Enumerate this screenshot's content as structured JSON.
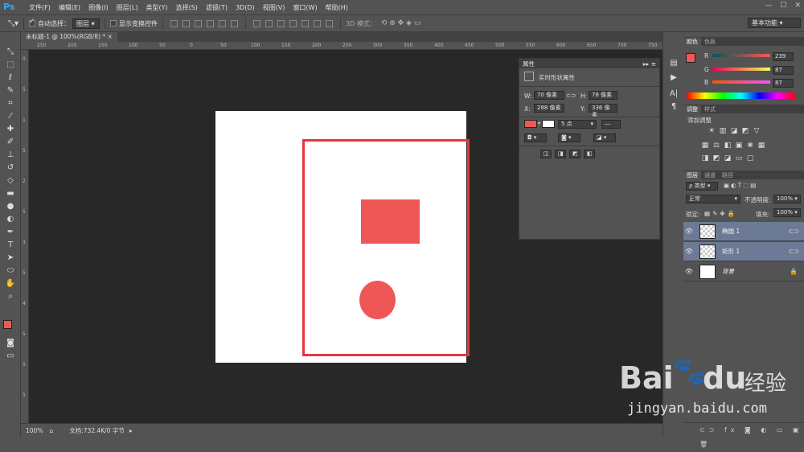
{
  "app": {
    "logo": "Ps"
  },
  "menu": [
    "文件(F)",
    "编辑(E)",
    "图像(I)",
    "图层(L)",
    "类型(Y)",
    "选择(S)",
    "滤镜(T)",
    "3D(D)",
    "视图(V)",
    "窗口(W)",
    "帮助(H)"
  ],
  "window_controls": [
    "—",
    "☐",
    "✕"
  ],
  "options": {
    "auto_select_label": "自动选择：",
    "auto_select_value": "图层",
    "show_transform_label": "显示变换控件",
    "mode_3d_label": "3D 模式：",
    "workspace": "基本功能"
  },
  "document": {
    "tab_title": "未标题-1 @ 100%(RGB/8) *"
  },
  "rulers": {
    "top": [
      "250",
      "200",
      "150",
      "100",
      "50",
      "0",
      "50",
      "100",
      "150",
      "200",
      "250",
      "300",
      "350",
      "400",
      "450",
      "500",
      "550",
      "600",
      "650",
      "700",
      "750"
    ],
    "left": [
      "0",
      "5",
      "1",
      "5",
      "2",
      "5",
      "3",
      "5",
      "4",
      "5",
      "5",
      "5"
    ]
  },
  "status": {
    "zoom": "100%",
    "doc_info": "文档:732.4K/0 字节"
  },
  "properties": {
    "title": "属性",
    "section": "实时形状属性",
    "w_label": "W:",
    "w_value": "70 像素",
    "h_label": "H:",
    "h_value": "78 像素",
    "x_label": "X:",
    "x_value": "288 像素",
    "y_label": "Y:",
    "y_value": "336 像素",
    "stroke_size": "5 点"
  },
  "color_panel": {
    "tabs": [
      "颜色",
      "色板"
    ],
    "r_label": "R",
    "r_value": "239",
    "g_label": "G",
    "g_value": "87",
    "b_label": "B",
    "b_value": "87",
    "fg_color": "#ef5757"
  },
  "adjust_panel": {
    "tabs": [
      "调整",
      "样式"
    ],
    "title": "添加调整"
  },
  "layers_panel": {
    "tabs": [
      "图层",
      "通道",
      "路径"
    ],
    "filter_label": "ρ 类型",
    "blend_mode": "正常",
    "opacity_label": "不透明度:",
    "opacity_value": "100%",
    "lock_label": "锁定:",
    "fill_label": "填充:",
    "fill_value": "100%",
    "layers": [
      {
        "name": "椭圆 1"
      },
      {
        "name": "矩形 1"
      },
      {
        "name": "背景"
      }
    ]
  },
  "watermark": {
    "brand": "Bai",
    "brand2": "du",
    "cn": "经验",
    "url": "jingyan.baidu.com"
  },
  "colors": {
    "accent": "#ef5757",
    "stroke": "#e8343a",
    "selection": "#6c7a96"
  }
}
